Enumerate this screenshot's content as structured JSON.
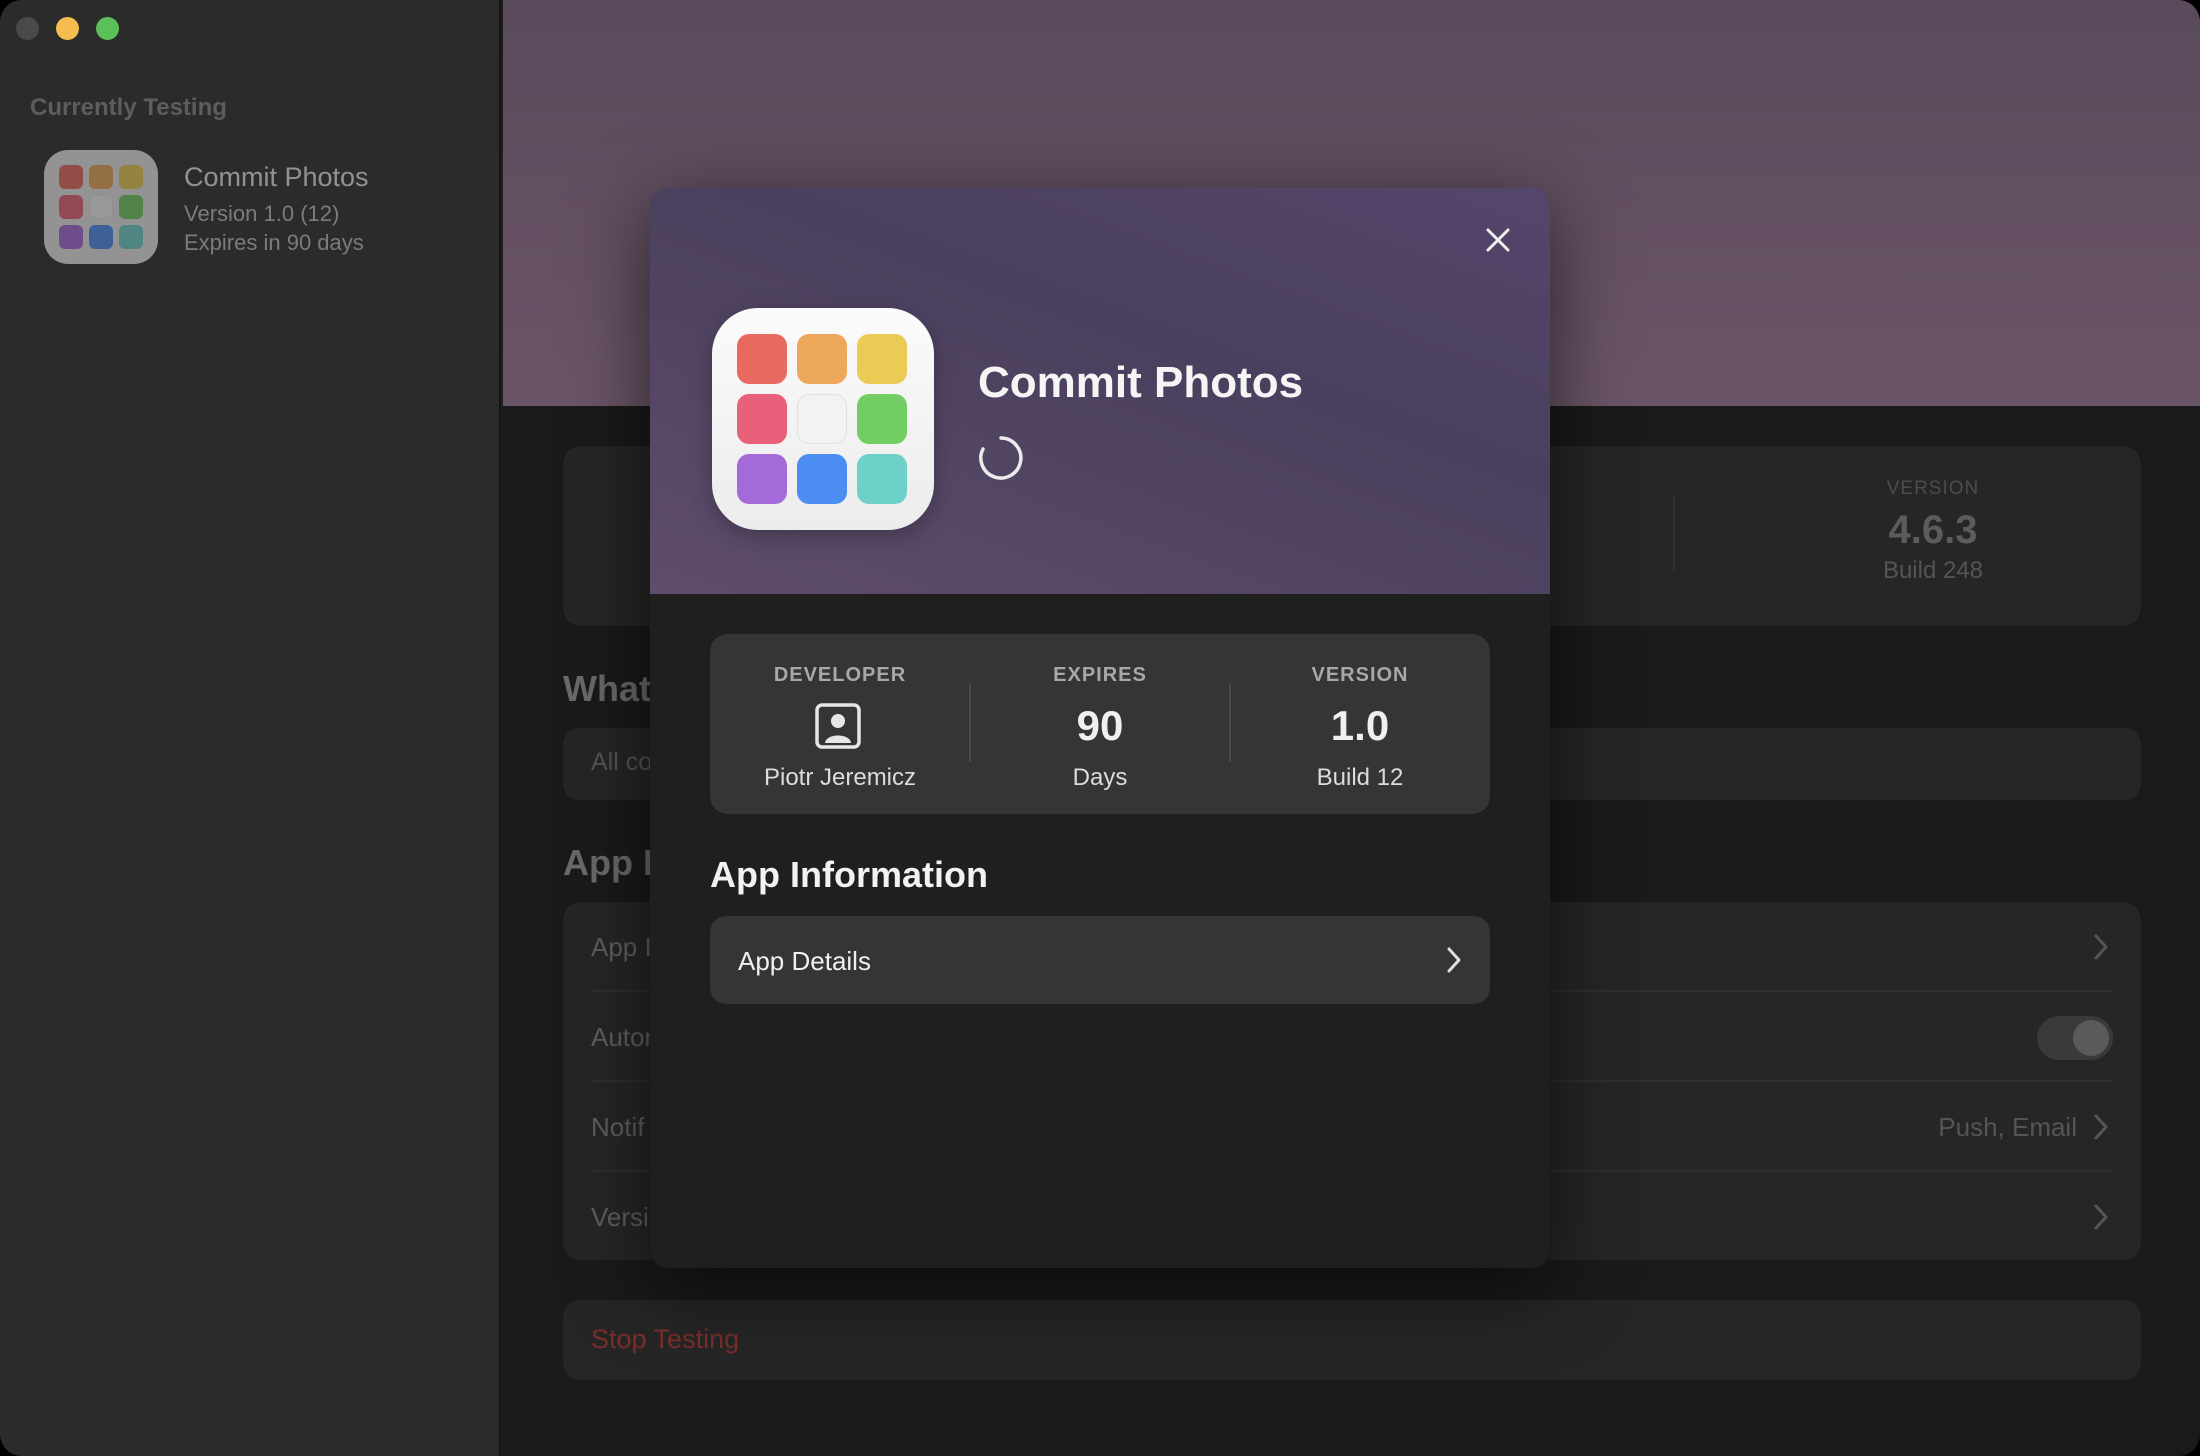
{
  "sidebar": {
    "section_title": "Currently Testing",
    "app": {
      "name": "Commit Photos",
      "version": "Version 1.0 (12)",
      "expires": "Expires in 90 days"
    }
  },
  "background": {
    "version_label": "VERSION",
    "version_value": "4.6.3",
    "version_build": "Build 248",
    "whats_new_heading": "What",
    "whats_new_text": "All co",
    "app_info_heading": "App I",
    "rows": [
      {
        "label": "App I",
        "value": ""
      },
      {
        "label": "Autor",
        "value": ""
      },
      {
        "label": "Notif",
        "value": "Push, Email"
      },
      {
        "label": "Versi",
        "value": ""
      }
    ],
    "stop_testing": "Stop Testing"
  },
  "modal": {
    "title": "Commit Photos",
    "developer": {
      "label": "DEVELOPER",
      "value": "Piotr Jeremicz"
    },
    "expires": {
      "label": "EXPIRES",
      "value": "90",
      "unit": "Days"
    },
    "version": {
      "label": "VERSION",
      "value": "1.0",
      "build": "Build 12"
    },
    "section_title": "App Information",
    "details_label": "App Details"
  },
  "icon_colors": [
    "#e8695f",
    "#eda75a",
    "#eccb55",
    "#e8607a",
    "#f2f2f2",
    "#72cd62",
    "#a46ad8",
    "#4b8df0",
    "#6dd0c9"
  ]
}
